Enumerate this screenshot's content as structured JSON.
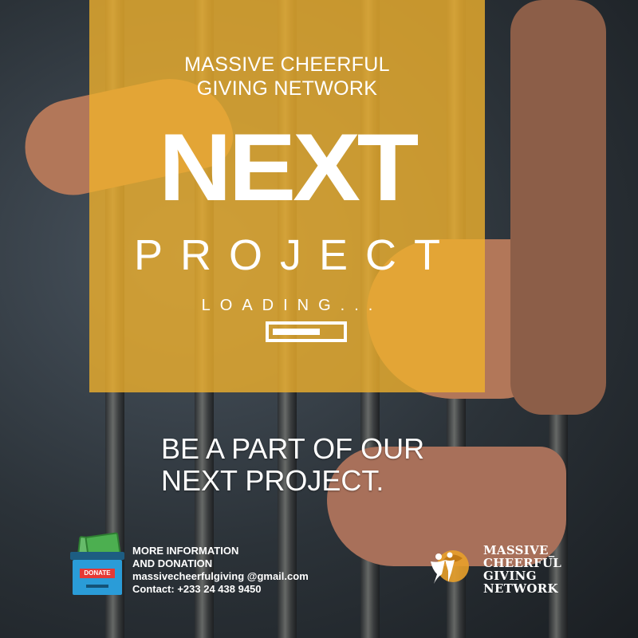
{
  "header": {
    "org_line1": "MASSIVE CHEERFUL",
    "org_line2": "GIVING NETWORK"
  },
  "hero": {
    "big_word": "NEXT",
    "sub_word": "PROJECT",
    "loading_text": "LOADING...",
    "loading_progress": 0.7
  },
  "cta": {
    "line1": "BE A PART OF OUR",
    "line2": "NEXT PROJECT."
  },
  "contact": {
    "donate_label": "DONATE",
    "line1": "MORE INFORMATION",
    "line2": "AND DONATION",
    "email": "massivecheerfulgiving @gmail.com",
    "phone": "Contact: +233 24 438 9450"
  },
  "logo": {
    "line1": "MASSIVE_",
    "line2": "CHEERFUL",
    "line3": "GIVING",
    "line4": "NETWORK"
  },
  "colors": {
    "overlay": "#efb02d",
    "text": "#ffffff",
    "logo_accent": "#e8a02a"
  }
}
